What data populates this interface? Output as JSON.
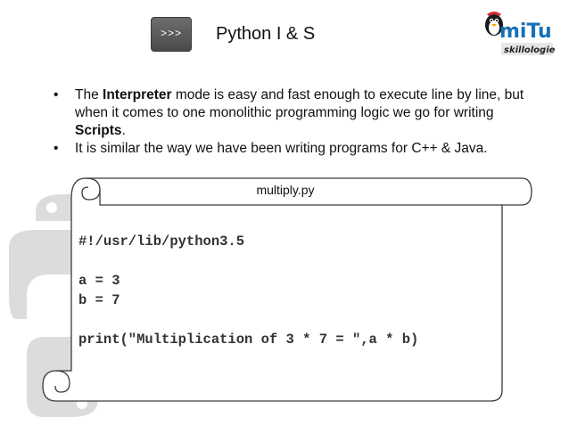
{
  "header": {
    "prompt_symbol": ">>>",
    "title": "Python I & S"
  },
  "logo": {
    "brand_text": "miTu",
    "tagline": "skillologies"
  },
  "bullets": [
    {
      "pre": "The ",
      "bold": "Interpreter",
      "mid": " mode is easy and fast enough to execute line by line, but when it comes to one monolithic programming logic we go for writing ",
      "bold2": "Scripts",
      "post": "."
    },
    {
      "text": "It is similar the way we have been writing programs for C++ & Java."
    }
  ],
  "bullet_symbol": "•",
  "script": {
    "filename": "multiply.py",
    "code_lines": [
      "#!/usr/lib/python3.5",
      "",
      "a = 3",
      "b = 7",
      "",
      "print(\"Multiplication of 3 * 7 = \",a * b)"
    ]
  }
}
